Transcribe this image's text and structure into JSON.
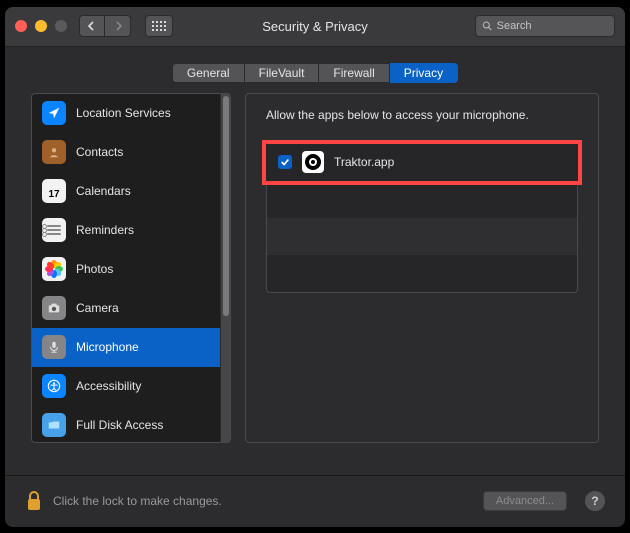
{
  "window": {
    "title": "Security & Privacy"
  },
  "search": {
    "placeholder": "Search"
  },
  "tabs": [
    {
      "label": "General",
      "active": false
    },
    {
      "label": "FileVault",
      "active": false
    },
    {
      "label": "Firewall",
      "active": false
    },
    {
      "label": "Privacy",
      "active": true
    }
  ],
  "sidebar": {
    "items": [
      {
        "label": "Location Services",
        "icon": "location",
        "active": false
      },
      {
        "label": "Contacts",
        "icon": "contacts",
        "active": false
      },
      {
        "label": "Calendars",
        "icon": "calendars",
        "active": false,
        "badge": "17"
      },
      {
        "label": "Reminders",
        "icon": "reminders",
        "active": false
      },
      {
        "label": "Photos",
        "icon": "photos",
        "active": false
      },
      {
        "label": "Camera",
        "icon": "camera",
        "active": false
      },
      {
        "label": "Microphone",
        "icon": "mic",
        "active": true
      },
      {
        "label": "Accessibility",
        "icon": "access",
        "active": false
      },
      {
        "label": "Full Disk Access",
        "icon": "disk",
        "active": false
      }
    ]
  },
  "main": {
    "description": "Allow the apps below to access your microphone.",
    "apps": [
      {
        "name": "Traktor.app",
        "checked": true,
        "highlighted": true
      }
    ],
    "empty_rows": 3
  },
  "footer": {
    "lock_text": "Click the lock to make changes.",
    "advanced_label": "Advanced...",
    "help_label": "?"
  },
  "colors": {
    "accent": "#0a62c7",
    "highlight": "#ff4444"
  }
}
